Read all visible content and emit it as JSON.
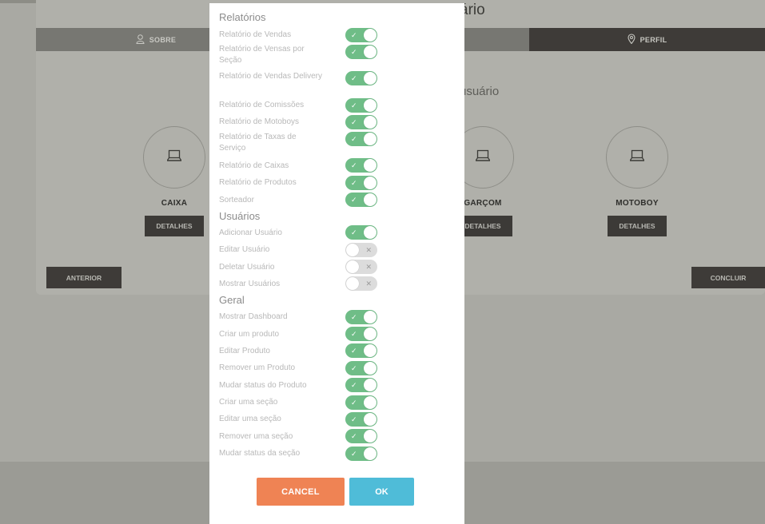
{
  "background": {
    "title_fragment": "ário",
    "tabs": {
      "sobre": "SOBRE",
      "perfil": "PERFIL"
    },
    "subtitle_fragment": "usuário",
    "roles": [
      {
        "name": "CAIXA",
        "details": "DETALHES"
      },
      {
        "name": "GARÇOM",
        "details": "DETALHES"
      },
      {
        "name": "MOTOBOY",
        "details": "DETALHES"
      }
    ],
    "anterior": "ANTERIOR",
    "concluir": "CONCLUIR"
  },
  "modal": {
    "sections": [
      {
        "title": "Relatórios",
        "items": [
          {
            "label": "Relatório de Vendas",
            "enabled": true
          },
          {
            "label": "Relatório de Vensas por Seção",
            "enabled": true
          },
          {
            "label": "Relatório de Vendas Delivery",
            "enabled": true
          },
          {
            "label": "Relatório de Comissões",
            "enabled": true
          },
          {
            "label": "Relatório de Motoboys",
            "enabled": true
          },
          {
            "label": "Relatório de Taxas de Serviço",
            "enabled": true
          },
          {
            "label": "Relatório de Caixas",
            "enabled": true
          },
          {
            "label": "Relatório de Produtos",
            "enabled": true
          },
          {
            "label": "Sorteador",
            "enabled": true
          }
        ]
      },
      {
        "title": "Usuários",
        "items": [
          {
            "label": "Adicionar Usuário",
            "enabled": true
          },
          {
            "label": "Editar Usuário",
            "enabled": false
          },
          {
            "label": "Deletar Usuário",
            "enabled": false
          },
          {
            "label": "Mostrar Usuários",
            "enabled": false
          }
        ]
      },
      {
        "title": "Geral",
        "items": [
          {
            "label": "Mostrar Dashboard",
            "enabled": true
          },
          {
            "label": "Criar um produto",
            "enabled": true
          },
          {
            "label": "Editar Produto",
            "enabled": true
          },
          {
            "label": "Remover um Produto",
            "enabled": true
          },
          {
            "label": "Mudar status do Produto",
            "enabled": true
          },
          {
            "label": "Criar uma seção",
            "enabled": true
          },
          {
            "label": "Editar uma seção",
            "enabled": true
          },
          {
            "label": "Remover uma seção",
            "enabled": true
          },
          {
            "label": "Mudar status da seção",
            "enabled": true
          }
        ]
      }
    ],
    "cancel": "CANCEL",
    "ok": "OK",
    "colors": {
      "toggle_on": "#6fbd87",
      "toggle_off": "#dcdcdc",
      "cancel": "#ef8354",
      "ok": "#4fbcd8"
    }
  }
}
